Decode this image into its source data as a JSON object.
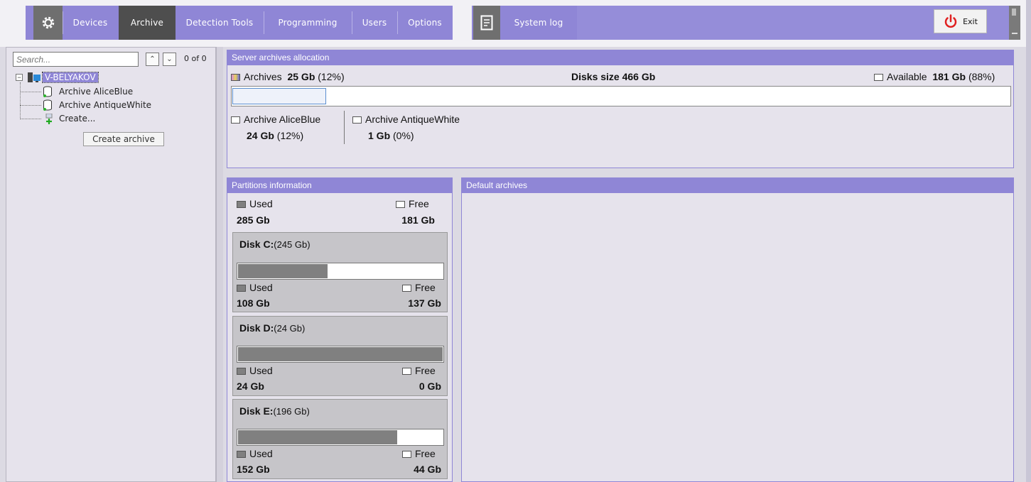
{
  "nav": {
    "items": [
      "Devices",
      "Archive",
      "Detection Tools",
      "Programming",
      "Users",
      "Options"
    ],
    "system_log": "System log",
    "exit": "Exit",
    "icons": {
      "settings": "gear-icon",
      "system_log": "document-icon",
      "exit": "power-icon"
    }
  },
  "tree": {
    "search_placeholder": "Search...",
    "counter": "0 of 0",
    "root": "V-BELYAKOV",
    "children": [
      "Archive AliceBlue",
      "Archive AntiqueWhite",
      "Create..."
    ],
    "create_button": "Create archive"
  },
  "allocation": {
    "title": "Server archives allocation",
    "archives_label": "Archives",
    "archives_size": "25 Gb",
    "archives_pct": "(12%)",
    "disks_size": "Disks size 466 Gb",
    "available_label": "Available",
    "available_size": "181 Gb",
    "available_pct": "(88%)",
    "archives_fraction": 0.12,
    "items": [
      {
        "name": "Archive AliceBlue",
        "size": "24 Gb",
        "pct": "(12%)"
      },
      {
        "name": "Archive AntiqueWhite",
        "size": "1 Gb",
        "pct": "(0%)"
      }
    ]
  },
  "partitions": {
    "title": "Partitions information",
    "used_label": "Used",
    "free_label": "Free",
    "used_total": "285 Gb",
    "free_total": "181 Gb",
    "disks": [
      {
        "name": "Disk C:",
        "size": "(245 Gb)",
        "used": "108 Gb",
        "free": "137 Gb",
        "used_fraction": 0.44
      },
      {
        "name": "Disk D:",
        "size": "(24 Gb)",
        "used": "24 Gb",
        "free": "0 Gb",
        "used_fraction": 1.0
      },
      {
        "name": "Disk E:",
        "size": "(196 Gb)",
        "used": "152 Gb",
        "free": "44 Gb",
        "used_fraction": 0.78
      }
    ]
  },
  "default_archives": {
    "title": "Default archives"
  },
  "colors": {
    "accent": "#8f86d6",
    "nav_active": "#4e4e4e",
    "used_bar": "#808080"
  }
}
